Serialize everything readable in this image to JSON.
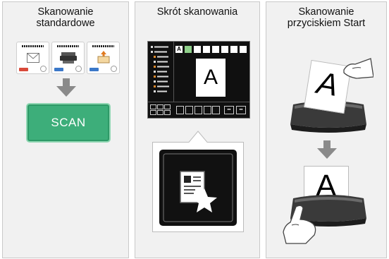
{
  "panels": [
    {
      "title_line1": "Skanowanie",
      "title_line2": "standardowe"
    },
    {
      "title_line1": "Skrót skanowania"
    },
    {
      "title_line1": "Skanowanie",
      "title_line2": "przyciskiem Start"
    }
  ],
  "standard": {
    "cards": [
      {
        "icon": "envelope-icon",
        "tag_color": "#d94a3a"
      },
      {
        "icon": "scanner-icon",
        "tag_color": "#3b78c8"
      },
      {
        "icon": "folder-upload-icon",
        "tag_color": "#3b78c8"
      }
    ],
    "scan_button_label": "SCAN",
    "button_color": "#3dae7a"
  },
  "shortcut": {
    "preview_letter": "A",
    "icon": "document-star-icon"
  },
  "start_button": {
    "paper_letter_top": "A",
    "paper_letter_bottom": "A"
  },
  "colors": {
    "panel_bg": "#f1f1f1",
    "accent_green": "#3dae7a",
    "selected_thumb": "#8fd08a"
  }
}
